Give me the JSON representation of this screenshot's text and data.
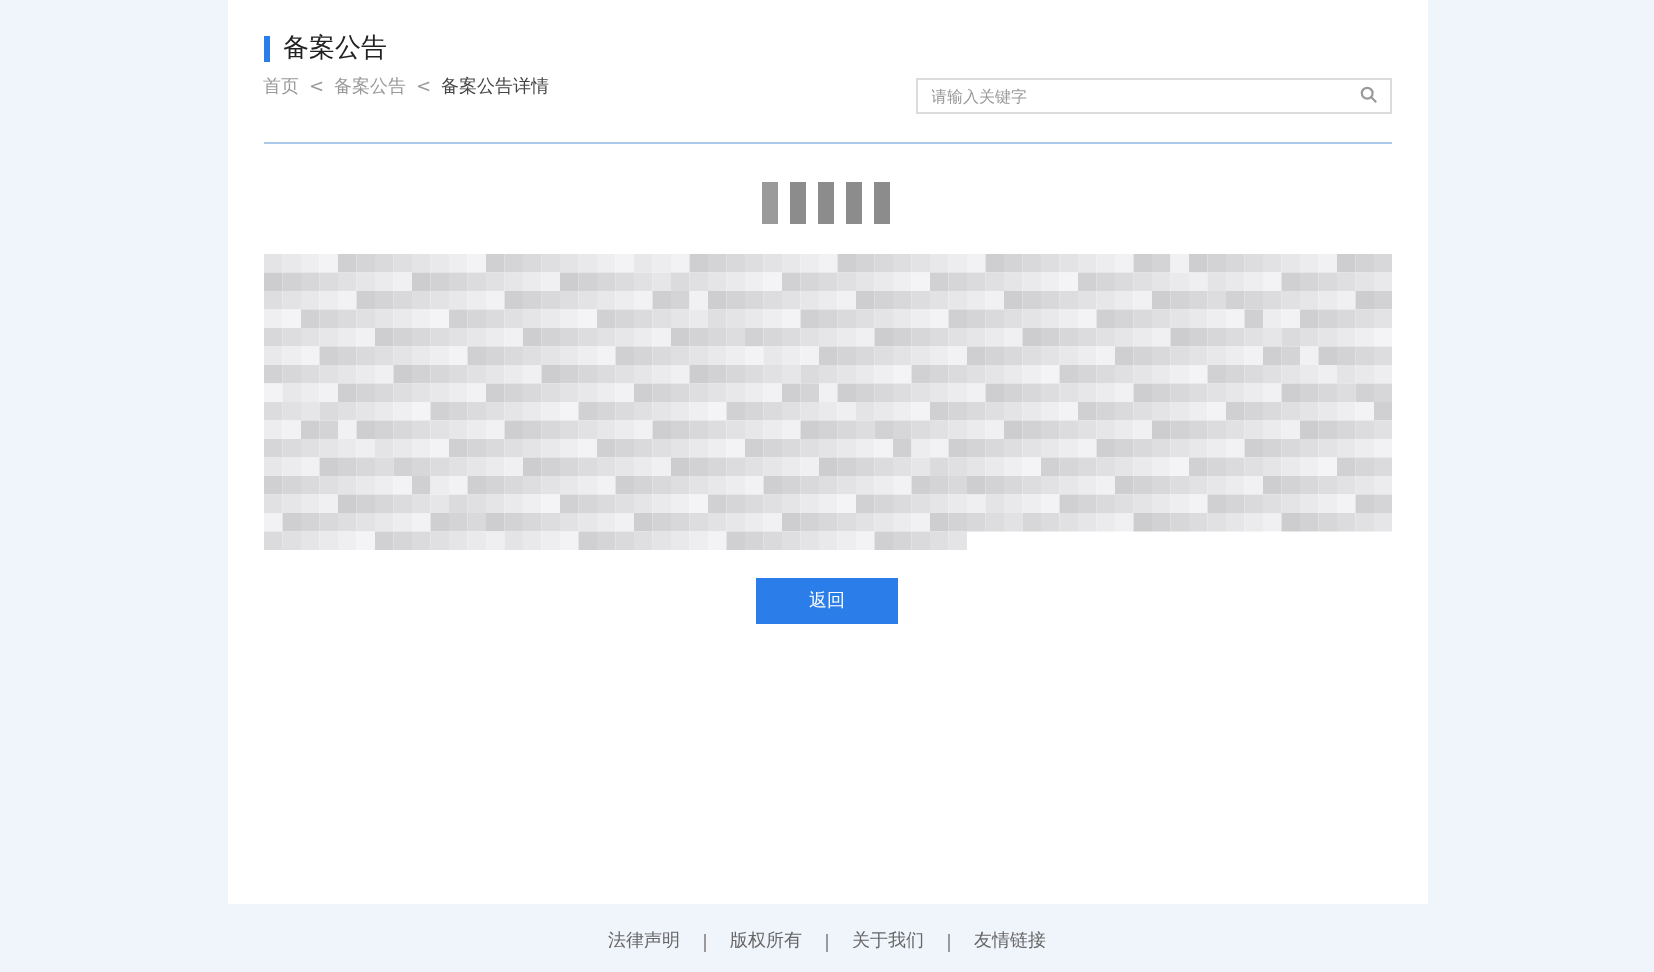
{
  "section_title": "备案公告",
  "breadcrumb": [
    {
      "label": "首页",
      "current": false
    },
    {
      "label": "备案公告",
      "current": false
    },
    {
      "label": "备案公告详情",
      "current": true
    }
  ],
  "breadcrumb_separator": "<",
  "search": {
    "placeholder": "请输入关键字"
  },
  "back_button": "返回",
  "footer_links": [
    "法律声明",
    "版权所有",
    "关于我们",
    "友情链接"
  ]
}
